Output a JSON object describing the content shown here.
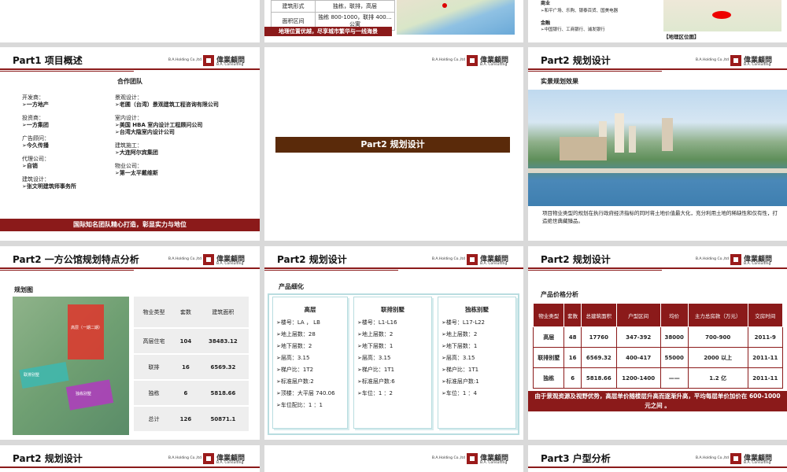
{
  "common": {
    "company": "B.A.Holding Co.,ltd",
    "logo_cn": "偉業顧問",
    "logo_en": "B.A. Consulting"
  },
  "top_left": {
    "rows": [
      {
        "label": "建筑形式",
        "value": "独栋，联排，高层"
      },
      {
        "label": "面积区间",
        "value": "独栋 800-1000，联排 400…公寓"
      }
    ],
    "banner": "地理位置优越，尽享城市繁华与一线海景"
  },
  "top_right": {
    "business_label": "商业",
    "business_text": "➢和平广场、乐购、银泰百货、国美电器",
    "finance_label": "金融",
    "finance_text": "➢中国银行、工商银行、浦发银行",
    "map_caption": "【地理区位图】"
  },
  "s1": {
    "title": "Part1  项目概述",
    "subtitle": "合作团队",
    "left": [
      {
        "role": "开发商：",
        "name": "➢一方地产"
      },
      {
        "role": "投资商：",
        "name": "➢一方集团"
      },
      {
        "role": "广告顾问：",
        "name": "➢今久传播"
      },
      {
        "role": "代理公司：",
        "name": "➢自销"
      },
      {
        "role": "建筑设计：",
        "name": "➢张文明建筑师事务所"
      }
    ],
    "right": [
      {
        "role": "景观设计：",
        "names": [
          "➢老圃（台湾）景观建筑工程咨询有限公司"
        ]
      },
      {
        "role": "室内设计：",
        "names": [
          "➢美国 HBA 室内设计工程顾问公司",
          "➢台湾大隐室内设计公司"
        ]
      },
      {
        "role": "建筑施工：",
        "names": [
          "➢大连阿尔宾集团"
        ]
      },
      {
        "role": "物业公司：",
        "names": [
          "➢第一太平戴维斯"
        ]
      }
    ],
    "bottom": "国际知名团队精心打造，彰显实力与地位"
  },
  "s2": {
    "title": "Part2  规划设计"
  },
  "s3": {
    "title": "Part2  规划设计",
    "subtitle": "实景规划效果",
    "text": "项目物业类型的规划在执行政府经济指标的同时将土地价值最大化，充分利用土地的稀缺性和仅有性，打造绝世典藏臻品。"
  },
  "s4": {
    "title": "Part2  一方公馆规划特点分析",
    "subtitle": "规划图",
    "labels": [
      "高层（一期二期）",
      "联排别墅",
      "独栋别墅"
    ],
    "headers": [
      "物业类型",
      "套数",
      "建筑面积"
    ],
    "rows": [
      [
        "高层住宅",
        "104",
        "38483.12"
      ],
      [
        "联排",
        "16",
        "6569.32"
      ],
      [
        "独栋",
        "6",
        "5818.66"
      ],
      [
        "总计",
        "126",
        "50871.1"
      ]
    ]
  },
  "s5": {
    "title": "Part2  规划设计",
    "subtitle": "产品细化",
    "cards": [
      {
        "title": "高层",
        "items": [
          "➢楼号：LA ， LB",
          "➢地上层数：28",
          "➢地下层数：2",
          "➢层高：3.15",
          "➢梯户比：1T2",
          "➢标准层户数:2",
          "➢顶楼：大平层 740.06",
          "➢车位配比：1 ：1"
        ]
      },
      {
        "title": "联排别墅",
        "items": [
          "➢楼号：L1-L16",
          "➢地上层数：2",
          "➢地下层数：1",
          "➢层高：3.15",
          "➢梯户比：1T1",
          "➢标准层户数:6",
          "➢车位：1 ：2"
        ]
      },
      {
        "title": "独栋别墅",
        "items": [
          "➢楼号：L17-L22",
          "➢地上层数：2",
          "➢地下层数：1",
          "➢层高：3.15",
          "➢梯户比：1T1",
          "➢标准层户数:1",
          "➢车位：1 ：4"
        ]
      }
    ]
  },
  "s6": {
    "title": "Part2  规划设计",
    "subtitle": "产品价格分析",
    "headers": [
      "物业类型",
      "套数",
      "总建筑面积",
      "户型区间",
      "均价",
      "主力总房款（万元）",
      "交房时间"
    ],
    "rows": [
      [
        "高层",
        "48",
        "17760",
        "347-392",
        "38000",
        "700-900",
        "2011-9"
      ],
      [
        "联排别墅",
        "16",
        "6569.32",
        "400-417",
        "55000",
        "2000 以上",
        "2011-11"
      ],
      [
        "独栋",
        "6",
        "5818.66",
        "1200-1400",
        "——",
        "1.2 亿",
        "2011-11"
      ]
    ],
    "bottom": "由于景观资源及视野优势，高层单价随楼层升高而逐渐升高，平均每层单价加价在 600-1000 元之间 。"
  },
  "s7": {
    "title": "Part2  规划设计"
  },
  "s9": {
    "title": "Part3  户型分析"
  }
}
